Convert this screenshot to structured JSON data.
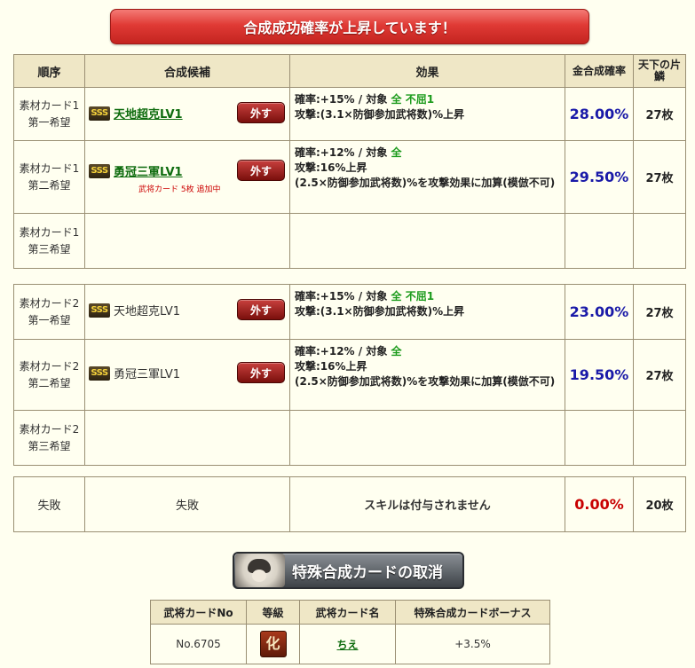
{
  "banner": "合成成功確率が上昇しています！",
  "headers": {
    "order": "順序",
    "candidate": "合成候補",
    "effect": "効果",
    "rate": "金合成確率",
    "cost": "天下の片鱗"
  },
  "remove_label": "外す",
  "group1": {
    "row1": {
      "order1": "素材カード1",
      "order2": "第一希望",
      "rarity": "SSS",
      "name": "天地超克LV1",
      "effect_line1_prefix": "確率:+15%  /  対象 ",
      "effect_target": "全",
      "effect_extra": " 不屈1",
      "effect_line2": "攻撃:(3.1×防御参加武将数)%上昇",
      "rate": "28.00%",
      "cost": "27枚"
    },
    "row2": {
      "order1": "素材カード1",
      "order2": "第二希望",
      "rarity": "SSS",
      "name": "勇冠三軍LV1",
      "note": "武将カード 5枚 追加中",
      "effect_line1_prefix": "確率:+12%  /  対象 ",
      "effect_target": "全",
      "effect_line2": "攻撃:16%上昇",
      "effect_line3": "(2.5×防御参加武将数)%を攻撃効果に加算(模倣不可)",
      "rate": "29.50%",
      "cost": "27枚"
    },
    "row3": {
      "order1": "素材カード1",
      "order2": "第三希望"
    }
  },
  "group2": {
    "row1": {
      "order1": "素材カード2",
      "order2": "第一希望",
      "rarity": "SSS",
      "name": "天地超克LV1",
      "effect_line1_prefix": "確率:+15%  /  対象 ",
      "effect_target": "全",
      "effect_extra": " 不屈1",
      "effect_line2": "攻撃:(3.1×防御参加武将数)%上昇",
      "rate": "23.00%",
      "cost": "27枚"
    },
    "row2": {
      "order1": "素材カード2",
      "order2": "第二希望",
      "rarity": "SSS",
      "name": "勇冠三軍LV1",
      "effect_line1_prefix": "確率:+12%  /  対象 ",
      "effect_target": "全",
      "effect_line2": "攻撃:16%上昇",
      "effect_line3": "(2.5×防御参加武将数)%を攻撃効果に加算(模倣不可)",
      "rate": "19.50%",
      "cost": "27枚"
    },
    "row3": {
      "order1": "素材カード2",
      "order2": "第三希望"
    }
  },
  "fail_row": {
    "order": "失敗",
    "candidate": "失敗",
    "effect": "スキルは付与されません",
    "rate": "0.00%",
    "cost": "20枚"
  },
  "cancel_button": "特殊合成カードの取消",
  "bonus_table": {
    "headers": [
      "武将カードNo",
      "等級",
      "武将カード名",
      "特殊合成カードボーナス"
    ],
    "row": {
      "no": "No.6705",
      "rank": "化",
      "name": "ちえ",
      "bonus": "+3.5%"
    }
  },
  "colors": {
    "banner": "#e03a35",
    "rate_blue": "#1a1aa8",
    "rate_red": "#c80000",
    "link_green": "#0d6b0d",
    "target_green": "#1a9a1a"
  }
}
